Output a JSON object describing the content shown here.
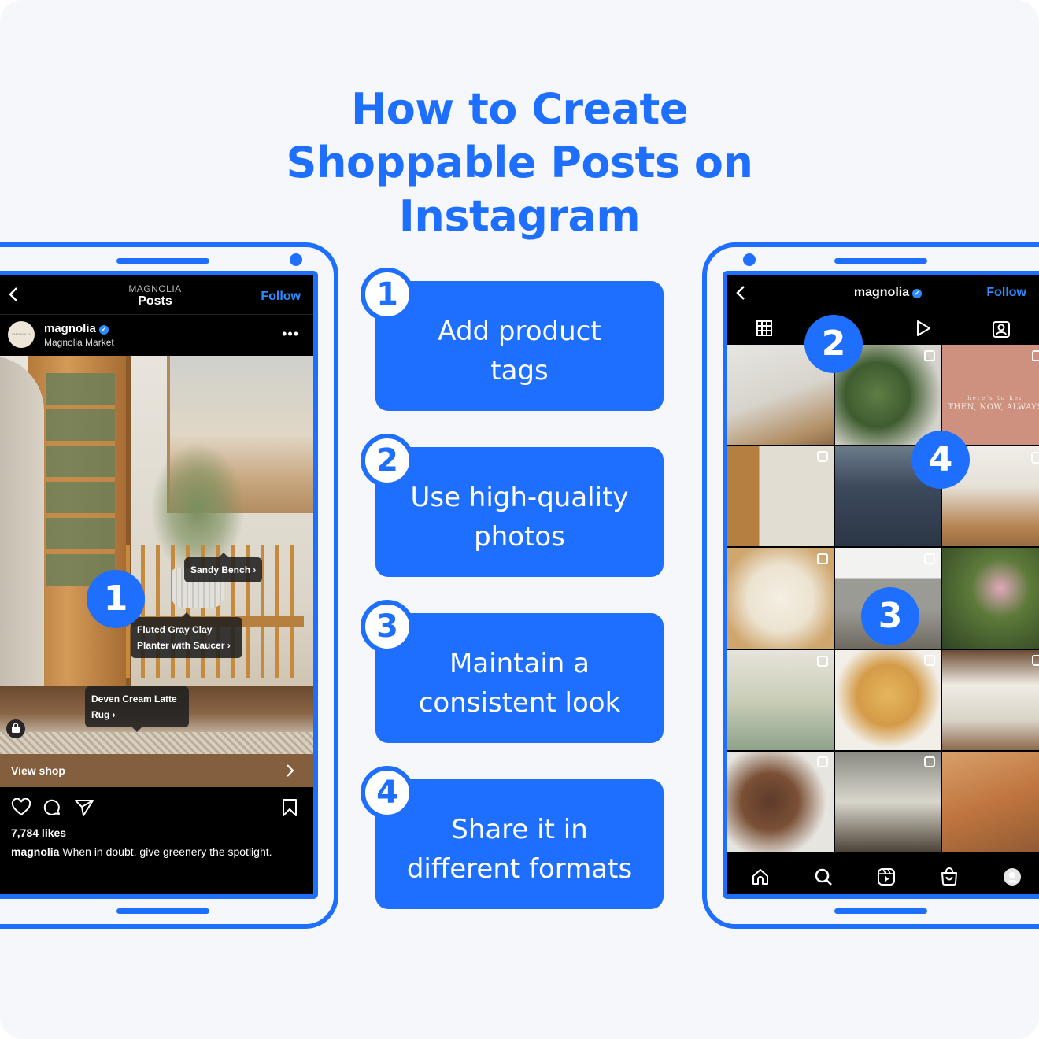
{
  "title": "How to Create Shoppable Posts on Instagram",
  "colors": {
    "brand_blue": "#1f6fff",
    "ig_link": "#2b8cff",
    "view_shop_bg": "#845f3d"
  },
  "steps": [
    {
      "number": "1",
      "label": "Add product tags"
    },
    {
      "number": "2",
      "label": "Use high-quality photos"
    },
    {
      "number": "3",
      "label": "Maintain a consistent look"
    },
    {
      "number": "4",
      "label": "Share it in different formats"
    }
  ],
  "left_phone": {
    "header_subtitle": "MAGNOLIA",
    "header_title": "Posts",
    "follow_label": "Follow",
    "account_name": "magnolia",
    "account_subtitle": "Magnolia Market",
    "avatar_text": "MAGNOLIA",
    "more_icon": "more-horizontal-icon",
    "callout_number": "1",
    "product_tags": [
      {
        "label": "Sandy Bench ›"
      },
      {
        "label": "Fluted Gray Clay Planter with Saucer ›"
      },
      {
        "label": "Deven Cream Latte Rug ›"
      }
    ],
    "view_shop_label": "View shop",
    "likes": "7,784 likes",
    "caption_user": "magnolia",
    "caption_text": "When in doubt, give greenery the spotlight."
  },
  "right_phone": {
    "profile_name": "magnolia",
    "follow_label": "Follow",
    "tabs": [
      "grid-icon",
      "reels-icon",
      "tagged-icon"
    ],
    "callouts": [
      "2",
      "4",
      "3"
    ],
    "grid_tile_text_small": "here's to her",
    "grid_tile_text": "THEN, NOW, ALWAYS",
    "bottom_nav": [
      "home-icon",
      "search-icon",
      "reels-icon",
      "shop-icon",
      "profile-icon"
    ]
  }
}
